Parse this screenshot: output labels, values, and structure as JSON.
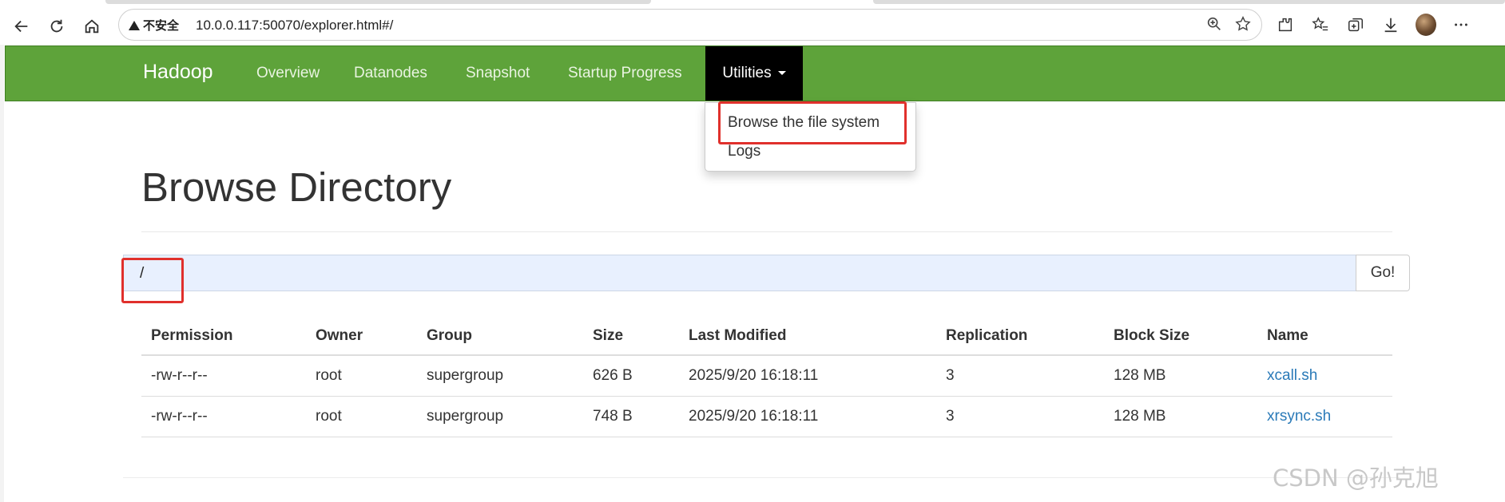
{
  "browser": {
    "security_label": "不安全",
    "url": "10.0.0.117:50070/explorer.html#/"
  },
  "navbar": {
    "brand": "Hadoop",
    "items": [
      {
        "label": "Overview"
      },
      {
        "label": "Datanodes"
      },
      {
        "label": "Snapshot"
      },
      {
        "label": "Startup Progress"
      },
      {
        "label": "Utilities",
        "active": true
      }
    ]
  },
  "dropdown": {
    "items": [
      {
        "label": "Browse the file system",
        "highlighted": true
      },
      {
        "label": "Logs"
      }
    ]
  },
  "main": {
    "title": "Browse Directory",
    "path_value": "/",
    "go_label": "Go!"
  },
  "table": {
    "headers": [
      "Permission",
      "Owner",
      "Group",
      "Size",
      "Last Modified",
      "Replication",
      "Block Size",
      "Name"
    ],
    "rows": [
      [
        "-rw-r--r--",
        "root",
        "supergroup",
        "626 B",
        "2025/9/20 16:18:11",
        "3",
        "128 MB",
        "xcall.sh"
      ],
      [
        "-rw-r--r--",
        "root",
        "supergroup",
        "748 B",
        "2025/9/20 16:18:11",
        "3",
        "128 MB",
        "xrsync.sh"
      ]
    ]
  },
  "watermark": "CSDN @孙克旭",
  "colors": {
    "navbar": "#5ea33a",
    "active_nav": "#000000",
    "highlight_box": "#e0302c",
    "link": "#2a7ab8",
    "path_input_bg": "#e8f0fe"
  }
}
